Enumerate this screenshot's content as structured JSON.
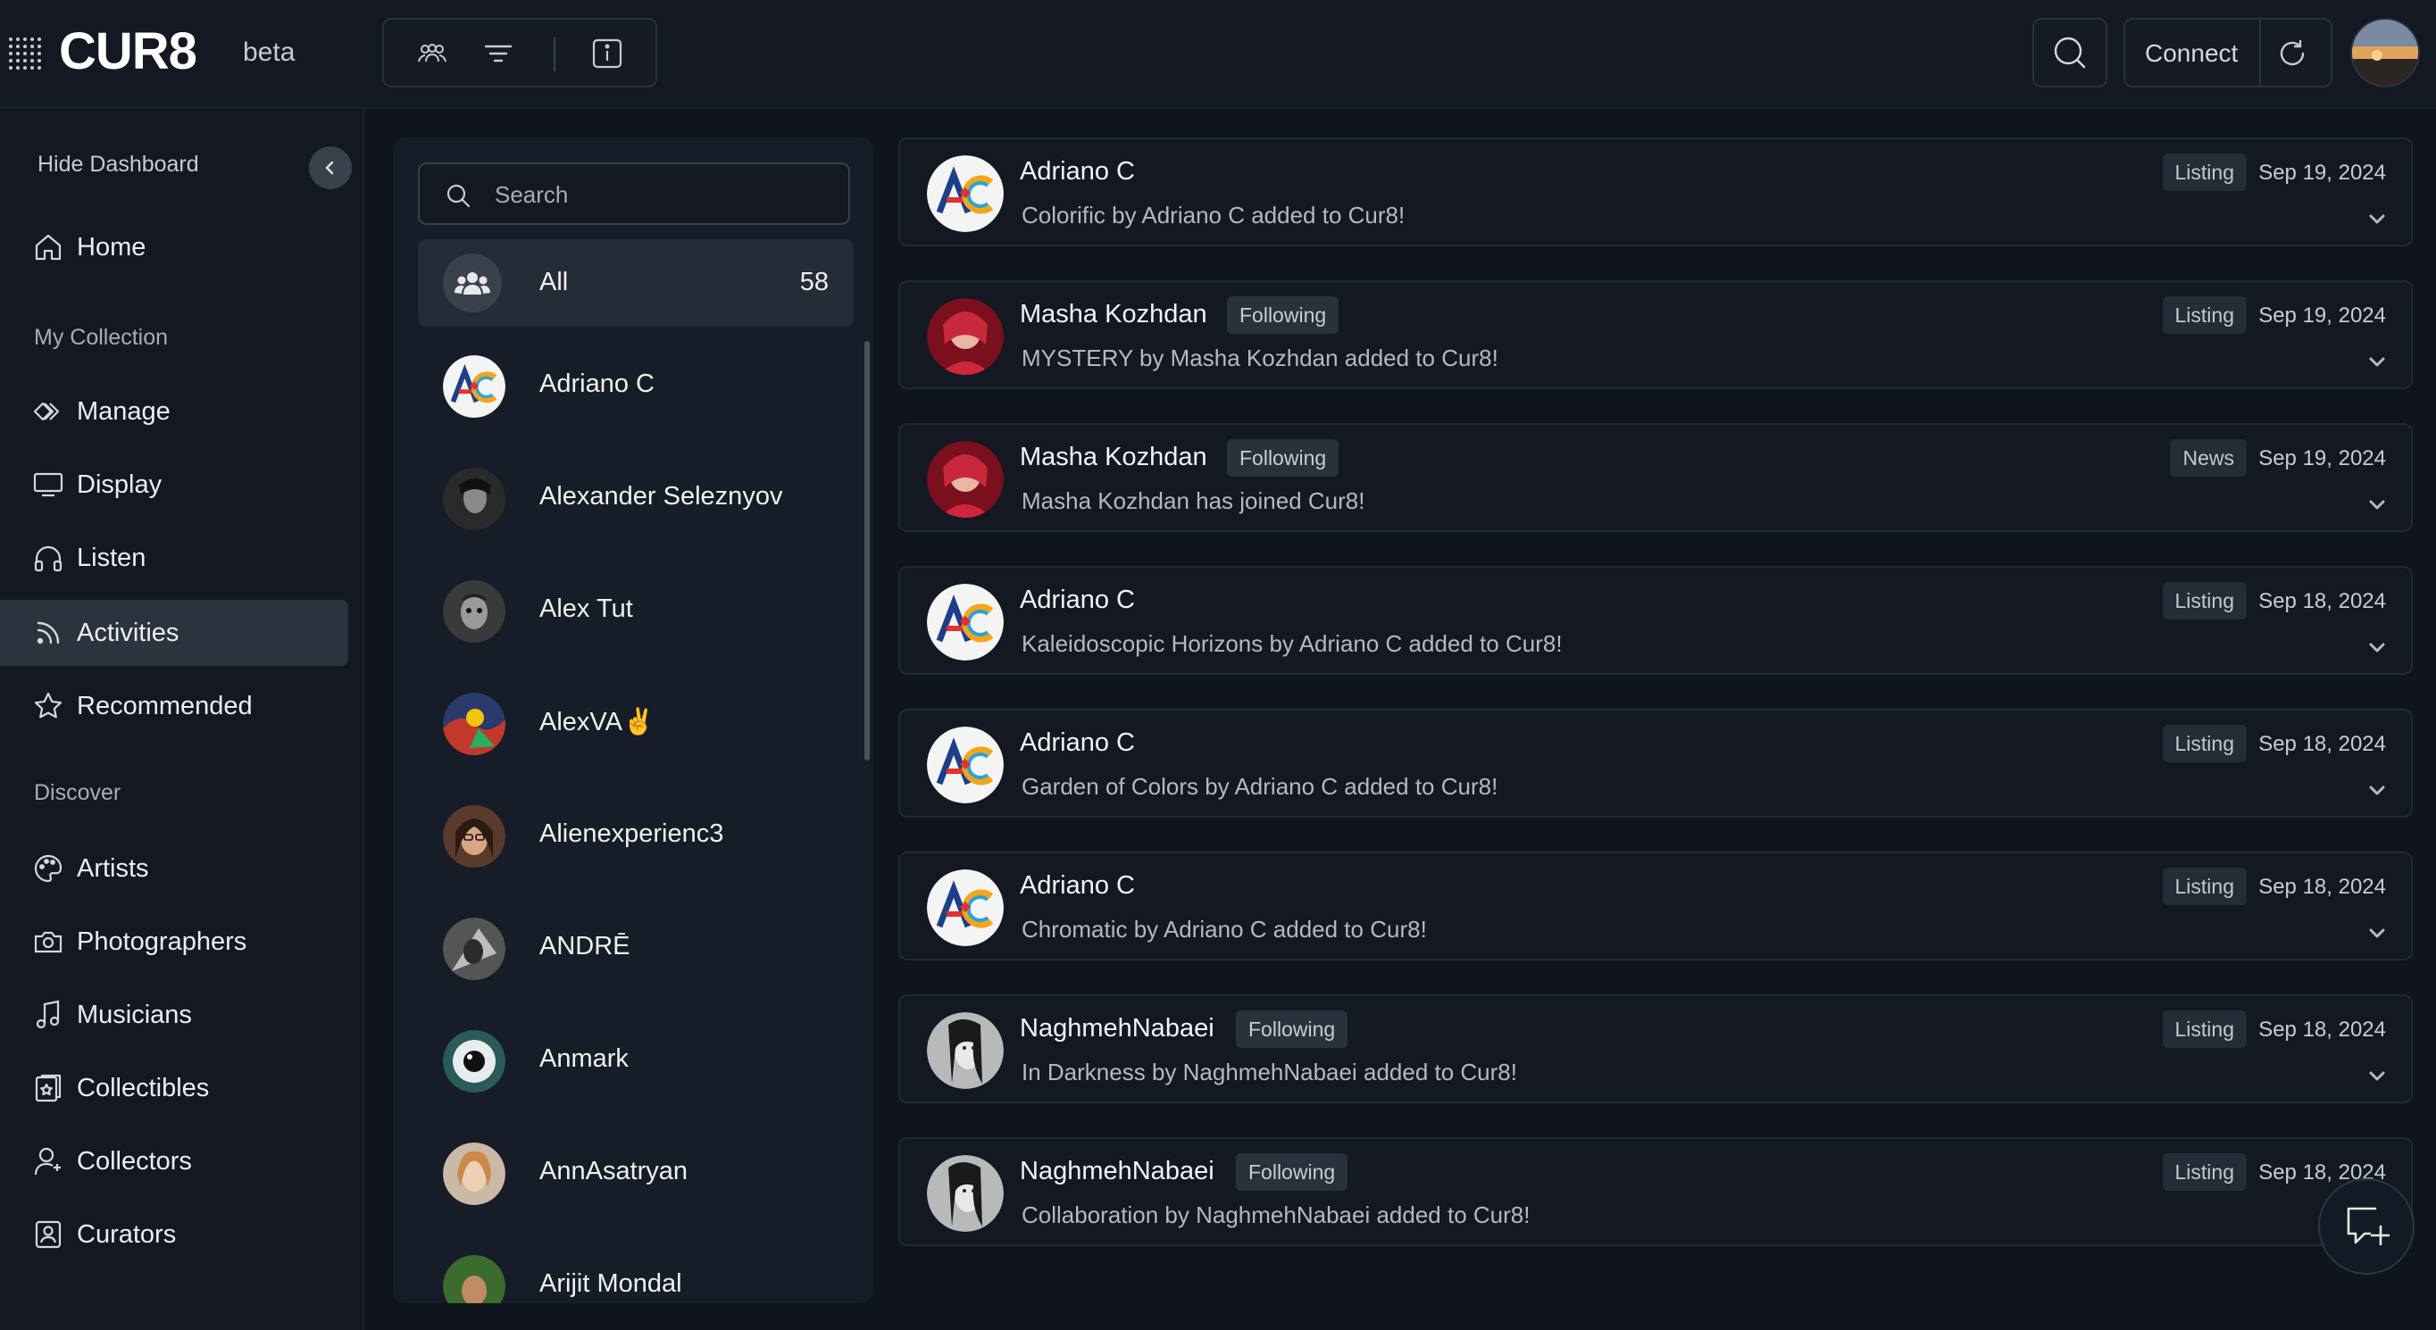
{
  "brand": {
    "logo_text": "CUR8",
    "beta_label": "beta"
  },
  "topbar": {
    "tools": [
      "people-icon",
      "filter-icon",
      "info-icon"
    ],
    "search_icon": "search-icon",
    "connect_label": "Connect",
    "refresh_icon": "refresh-icon"
  },
  "sidebar": {
    "hide_label": "Hide Dashboard",
    "home": "Home",
    "my_collection_label": "My Collection",
    "manage": "Manage",
    "display": "Display",
    "listen": "Listen",
    "activities": "Activities",
    "recommended": "Recommended",
    "discover_label": "Discover",
    "artists": "Artists",
    "photographers": "Photographers",
    "musicians": "Musicians",
    "collectibles": "Collectibles",
    "collectors": "Collectors",
    "curators": "Curators"
  },
  "people": {
    "search_placeholder": "Search",
    "all_label": "All",
    "all_count": "58",
    "list": [
      {
        "name": "Adriano C",
        "avatar": "ac"
      },
      {
        "name": "Alexander Seleznyov",
        "avatar": "bw1"
      },
      {
        "name": "Alex Tut",
        "avatar": "bw2"
      },
      {
        "name": "AlexVA✌️",
        "avatar": "color1"
      },
      {
        "name": "Alienexperienc3",
        "avatar": "face1"
      },
      {
        "name": "ANDRĒ",
        "avatar": "bw3"
      },
      {
        "name": "Anmark",
        "avatar": "eye"
      },
      {
        "name": "AnnAsatryan",
        "avatar": "face2"
      },
      {
        "name": "Arijit Mondal",
        "avatar": "green"
      }
    ]
  },
  "feed": [
    {
      "name": "Adriano C",
      "following": "",
      "text": "Colorific by Adriano C added to Cur8!",
      "type": "Listing",
      "date": "Sep 19, 2024",
      "avatar": "ac"
    },
    {
      "name": "Masha Kozhdan",
      "following": "Following",
      "text": "MYSTERY by Masha Kozhdan added to Cur8!",
      "type": "Listing",
      "date": "Sep 19, 2024",
      "avatar": "red"
    },
    {
      "name": "Masha Kozhdan",
      "following": "Following",
      "text": "Masha Kozhdan has joined Cur8!",
      "type": "News",
      "date": "Sep 19, 2024",
      "avatar": "red"
    },
    {
      "name": "Adriano C",
      "following": "",
      "text": "Kaleidoscopic Horizons by Adriano C added to Cur8!",
      "type": "Listing",
      "date": "Sep 18, 2024",
      "avatar": "ac"
    },
    {
      "name": "Adriano C",
      "following": "",
      "text": "Garden of Colors by Adriano C added to Cur8!",
      "type": "Listing",
      "date": "Sep 18, 2024",
      "avatar": "ac"
    },
    {
      "name": "Adriano C",
      "following": "",
      "text": "Chromatic by Adriano C added to Cur8!",
      "type": "Listing",
      "date": "Sep 18, 2024",
      "avatar": "ac"
    },
    {
      "name": "NaghmehNabaei",
      "following": "Following",
      "text": "In Darkness by NaghmehNabaei added to Cur8!",
      "type": "Listing",
      "date": "Sep 18, 2024",
      "avatar": "bwface"
    },
    {
      "name": "NaghmehNabaei",
      "following": "Following",
      "text": "Collaboration by NaghmehNabaei added to Cur8!",
      "type": "Listing",
      "date": "Sep 18, 2024",
      "avatar": "bwface"
    }
  ],
  "fab_icon": "new-message-icon"
}
